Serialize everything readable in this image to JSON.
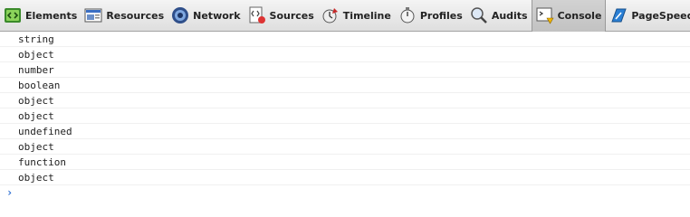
{
  "toolbar": {
    "tabs": [
      {
        "label": "Elements",
        "icon": "elements-icon"
      },
      {
        "label": "Resources",
        "icon": "resources-icon"
      },
      {
        "label": "Network",
        "icon": "network-icon"
      },
      {
        "label": "Sources",
        "icon": "sources-icon"
      },
      {
        "label": "Timeline",
        "icon": "timeline-icon"
      },
      {
        "label": "Profiles",
        "icon": "profiles-icon"
      },
      {
        "label": "Audits",
        "icon": "audits-icon"
      },
      {
        "label": "Console",
        "icon": "console-icon",
        "selected": true
      },
      {
        "label": "PageSpeed",
        "icon": "pagespeed-icon"
      }
    ]
  },
  "console": {
    "lines": [
      "string",
      "object",
      "number",
      "boolean",
      "object",
      "object",
      "undefined",
      "object",
      "function",
      "object"
    ],
    "prompt": "›"
  },
  "colors": {
    "prompt": "#2d6fd2",
    "selected_tab": "#c8c8c8"
  }
}
